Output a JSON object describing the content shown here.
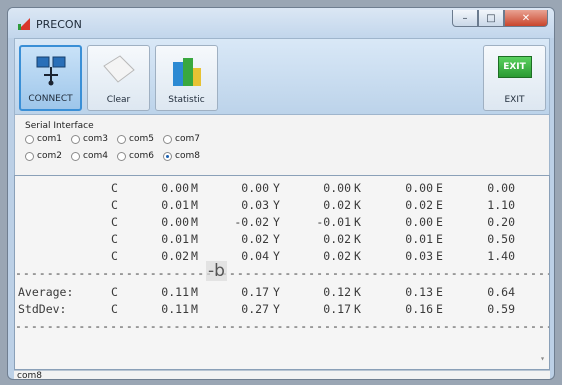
{
  "window": {
    "title": "PRECON"
  },
  "toolbar": {
    "connect": "CONNECT",
    "clear": "Clear",
    "statistic": "Statistic",
    "exit": "EXIT",
    "exit_icon_text": "EXIT"
  },
  "serial": {
    "title": "Serial Interface",
    "ports": [
      "com1",
      "com3",
      "com5",
      "com7",
      "com2",
      "com4",
      "com6",
      "com8"
    ],
    "selected": "com8"
  },
  "output": {
    "rows": [
      [
        "C",
        "0.00",
        "M",
        "0.00",
        "Y",
        "0.00",
        "K",
        "0.00",
        "E",
        "0.00"
      ],
      [
        "C",
        "0.01",
        "M",
        "0.03",
        "Y",
        "0.02",
        "K",
        "0.02",
        "E",
        "1.10"
      ],
      [
        "C",
        "0.00",
        "M",
        "-0.02",
        "Y",
        "-0.01",
        "K",
        "0.00",
        "E",
        "0.20"
      ],
      [
        "C",
        "0.01",
        "M",
        "0.02",
        "Y",
        "0.02",
        "K",
        "0.01",
        "E",
        "0.50"
      ],
      [
        "C",
        "0.02",
        "M",
        "0.04",
        "Y",
        "0.02",
        "K",
        "0.03",
        "E",
        "1.40"
      ]
    ],
    "average": {
      "label": "Average:",
      "values": [
        "C",
        "0.11",
        "M",
        "0.17",
        "Y",
        "0.12",
        "K",
        "0.13",
        "E",
        "0.64"
      ]
    },
    "stddev": {
      "label": "StdDev:",
      "values": [
        "C",
        "0.11",
        "M",
        "0.27",
        "Y",
        "0.17",
        "K",
        "0.16",
        "E",
        "0.59"
      ]
    },
    "overlay_text": "-b"
  },
  "status": {
    "text": "com8"
  },
  "colors": {
    "accent": "#3a8fd6",
    "exit_green": "#2fae3a"
  }
}
